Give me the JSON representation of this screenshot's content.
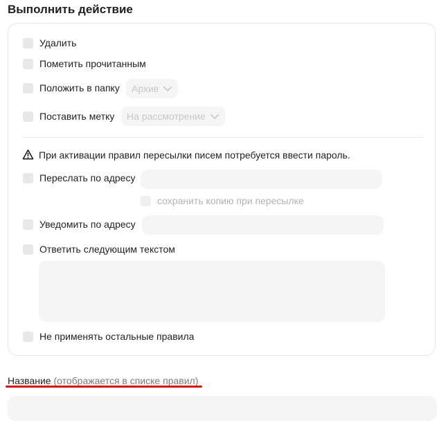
{
  "section_title": "Выполнить действие",
  "actions": {
    "delete_label": "Удалить",
    "mark_read_label": "Пометить прочитанным",
    "move_to_folder_label": "Положить в папку",
    "folder_select_value": "Архив",
    "set_label_label": "Поставить метку",
    "label_select_value": "На рассмотрение",
    "warning_text": "При активации правил пересылки писем потребуется ввести пароль.",
    "forward_label": "Переслать по адресу",
    "forward_input_value": "",
    "keep_copy_label": "сохранить копию при пересылке",
    "notify_label": "Уведомить по адресу",
    "notify_input_value": "",
    "reply_label": "Ответить следующим текстом",
    "reply_text_value": "",
    "stop_rules_label": "Не применять остальные правила"
  },
  "name_field": {
    "label": "Название",
    "hint": "(отображается в списке правил)",
    "value": ""
  },
  "colors": {
    "underline": "#d70f0f",
    "field_bg": "#f5f5f5",
    "checkbox_bg": "#e8e8e8"
  },
  "icons": {
    "warning": "warning-triangle-icon",
    "dropdown": "chevron-down-icon"
  }
}
